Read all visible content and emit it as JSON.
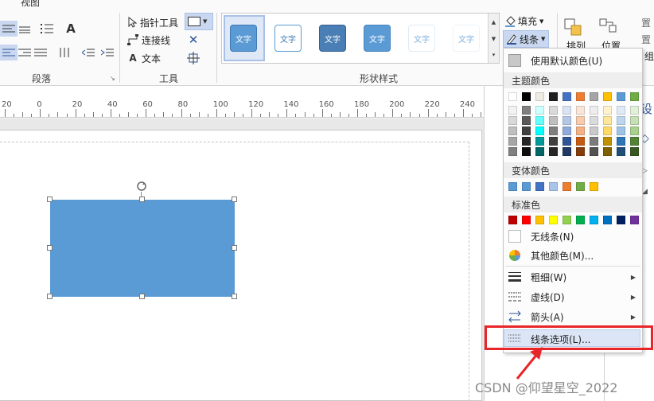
{
  "ribbon": {
    "tab_partial": "视图",
    "groups": {
      "paragraph": "段落",
      "tools": "工具",
      "shape_styles": "形状样式"
    },
    "tools": {
      "pointer": "指针工具",
      "connector": "连接线",
      "text": "文本"
    },
    "style_tile_text": "文字",
    "fill_label": "填充",
    "line_label": "线条",
    "arrange_label": "排列",
    "position_label": "位置",
    "group_partial": "组",
    "set_partial": "置"
  },
  "ruler": {
    "labels": [
      "20",
      "0",
      "20",
      "40",
      "60",
      "80",
      "100",
      "120",
      "140",
      "160",
      "180",
      "200",
      "220",
      "240",
      "260",
      "280"
    ]
  },
  "line_menu": {
    "default_color": "使用默认颜色(U)",
    "theme_colors": "主题颜色",
    "variant_colors": "变体颜色",
    "standard_colors": "标准色",
    "no_line": "无线条(N)",
    "more_colors": "其他颜色(M)...",
    "weight": "粗细(W)",
    "dash": "虚线(D)",
    "arrows": "箭头(A)",
    "line_options": "线条选项(L)..."
  },
  "colors": {
    "theme_top": [
      "#ffffff",
      "#000000",
      "#eeece1",
      "#1f1f1f",
      "#4472c4",
      "#ed7d31",
      "#a5a5a5",
      "#ffc000",
      "#5b9bd5",
      "#70ad47"
    ],
    "theme_cols": [
      [
        "#f2f2f2",
        "#d9d9d9",
        "#bfbfbf",
        "#a6a6a6",
        "#808080"
      ],
      [
        "#7f7f7f",
        "#595959",
        "#404040",
        "#262626",
        "#0d0d0d"
      ],
      [
        "#ccffff",
        "#66ffff",
        "#00ffff",
        "#009999",
        "#006666"
      ],
      [
        "#d9d9d9",
        "#bfbfbf",
        "#7f7f7f",
        "#404040",
        "#262626"
      ],
      [
        "#dae3f3",
        "#b4c7e7",
        "#8faadc",
        "#2f5597",
        "#1f3864"
      ],
      [
        "#fbe5d6",
        "#f8cbad",
        "#f4b183",
        "#c55a11",
        "#843c0c"
      ],
      [
        "#ededed",
        "#dbdbdb",
        "#c9c9c9",
        "#7b7b7b",
        "#525252"
      ],
      [
        "#fff2cc",
        "#ffe699",
        "#ffd966",
        "#bf9000",
        "#7f6000"
      ],
      [
        "#deebf7",
        "#bdd7ee",
        "#9dc3e6",
        "#2e75b6",
        "#1f4e79"
      ],
      [
        "#e2f0d9",
        "#c5e0b4",
        "#a9d18e",
        "#548235",
        "#385723"
      ]
    ],
    "variant": [
      "#5b9bd5",
      "#5b9bd5",
      "#4472c4",
      "#a9c4eb",
      "#ed7d31",
      "#70ad47",
      "#ffc000"
    ],
    "standard": [
      "#c00000",
      "#ff0000",
      "#ffc000",
      "#ffff00",
      "#92d050",
      "#00b050",
      "#00b0f0",
      "#0070c0",
      "#002060",
      "#7030a0"
    ],
    "shape_fill": "#5b9bd5",
    "highlight_red": "#e8262a"
  },
  "watermark": "CSDN @仰望星空_2022"
}
